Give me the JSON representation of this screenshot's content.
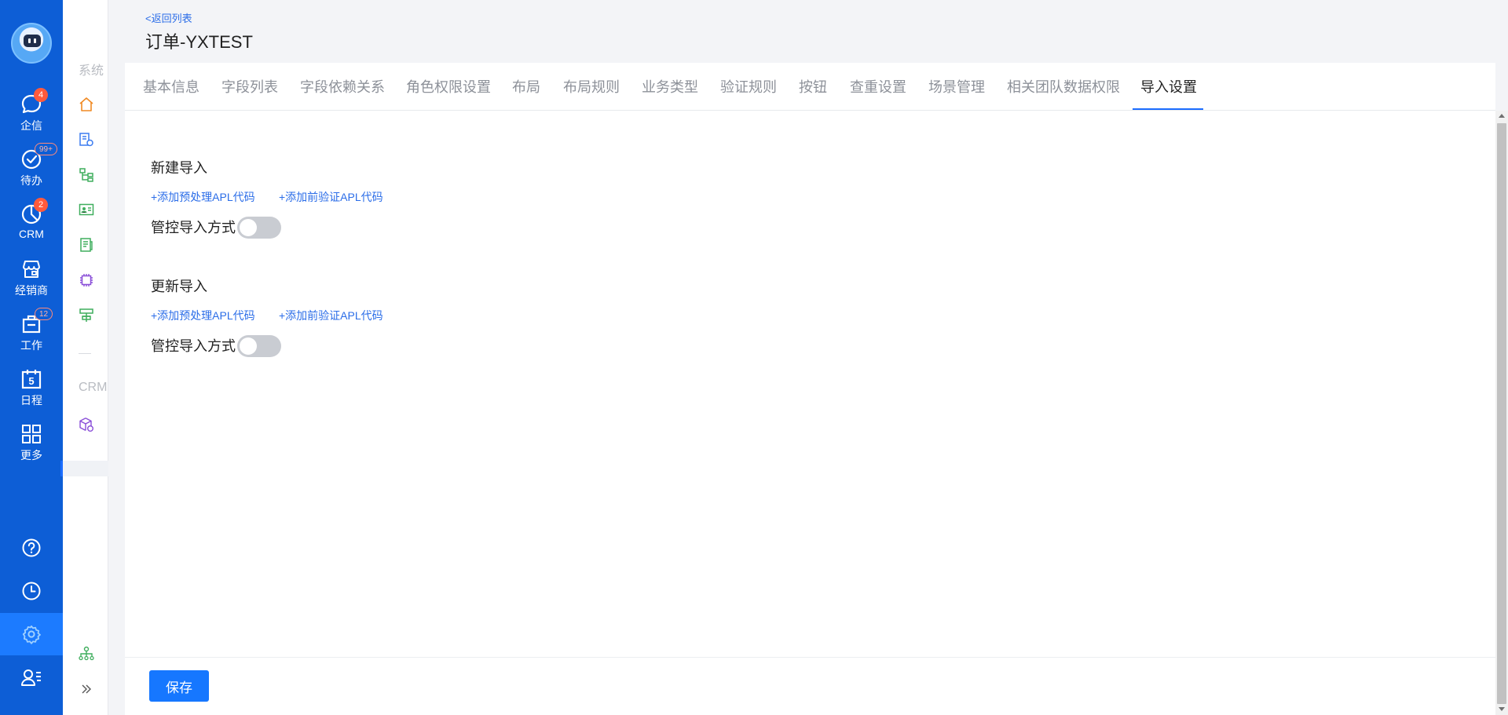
{
  "nav": {
    "items": [
      {
        "label": "企信",
        "badge": "4",
        "icon": "chat-icon"
      },
      {
        "label": "待办",
        "badge": "99+",
        "icon": "check-circle-icon"
      },
      {
        "label": "CRM",
        "badge": "2",
        "icon": "pie-chart-icon"
      },
      {
        "label": "经销商",
        "badge": "",
        "icon": "store-icon"
      },
      {
        "label": "工作",
        "badge": "12",
        "icon": "briefcase-icon"
      },
      {
        "label": "日程",
        "badge": "",
        "icon": "calendar-icon",
        "calendar_day": "5"
      },
      {
        "label": "更多",
        "badge": "",
        "icon": "grid-icon"
      }
    ],
    "bottom": [
      "help-icon",
      "clock-icon",
      "settings-icon",
      "user-list-icon"
    ],
    "colors": {
      "background": "#0d5ed6",
      "active": "#1c7bff",
      "badge": "#ff5a3c"
    }
  },
  "sidebar": {
    "group1_label": "系统",
    "group2_label": "CRM",
    "icons": [
      "home-icon",
      "object-settings-icon",
      "tree-icon",
      "contact-card-icon",
      "document-list-icon",
      "chip-icon",
      "flow-icon",
      "package-settings-icon",
      "org-chart-icon",
      "expand-icon"
    ]
  },
  "header": {
    "back_link": "<返回列表",
    "title": "订单-YXTEST"
  },
  "tabs": {
    "items": [
      "基本信息",
      "字段列表",
      "字段依赖关系",
      "角色权限设置",
      "布局",
      "布局规则",
      "业务类型",
      "验证规则",
      "按钮",
      "查重设置",
      "场景管理",
      "相关团队数据权限",
      "导入设置"
    ],
    "active": "导入设置"
  },
  "sections": {
    "new_import": {
      "title": "新建导入",
      "link_preprocess": "+添加预处理APL代码",
      "link_prevalidate": "+添加前验证APL代码",
      "control_label": "管控导入方式",
      "toggle_on": false
    },
    "update_import": {
      "title": "更新导入",
      "link_preprocess": "+添加预处理APL代码",
      "link_prevalidate": "+添加前验证APL代码",
      "control_label": "管控导入方式",
      "toggle_on": false
    }
  },
  "footer": {
    "save_label": "保存"
  },
  "colors": {
    "primary": "#1677ff",
    "link": "#2b6de8",
    "tab_underline": "#1c6dff"
  }
}
